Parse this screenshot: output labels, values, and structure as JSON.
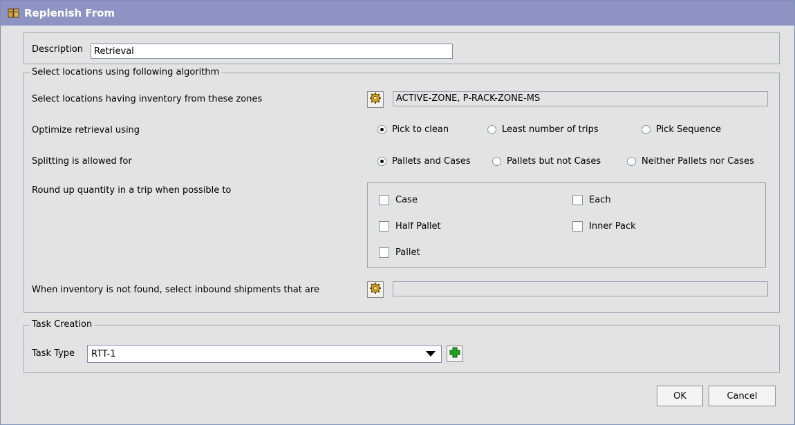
{
  "window": {
    "title": "Replenish From"
  },
  "description": {
    "label": "Description",
    "value": "Retrieval"
  },
  "algorithm": {
    "legend": "Select locations using following algorithm",
    "zones_label": "Select locations having inventory from these zones",
    "zones_value": "ACTIVE-ZONE, P-RACK-ZONE-MS",
    "optimize_label": "Optimize retrieval using",
    "optimize_options": [
      "Pick to clean",
      "Least number of trips",
      "Pick Sequence"
    ],
    "optimize_selected": "Pick to clean",
    "splitting_label": "Splitting is allowed for",
    "splitting_options": [
      "Pallets and Cases",
      "Pallets but not Cases",
      "Neither Pallets nor Cases"
    ],
    "splitting_selected": "Pallets and Cases",
    "roundup_label": "Round up quantity in a trip when possible to",
    "roundup_options": [
      "Case",
      "Each",
      "Half Pallet",
      "Inner Pack",
      "Pallet"
    ],
    "inbound_label": "When inventory is not found, select inbound shipments that are",
    "inbound_value": ""
  },
  "task_creation": {
    "legend": "Task Creation",
    "task_type_label": "Task Type",
    "task_type_value": "RTT-1"
  },
  "buttons": {
    "ok": "OK",
    "cancel": "Cancel"
  },
  "icons": {
    "title": "package-icon",
    "lookup": "gear-lookup-icon",
    "add": "plus-icon"
  },
  "colors": {
    "titlebar": "#8e93c4",
    "background": "#e3e3e3",
    "add_green": "#1fa11f"
  }
}
